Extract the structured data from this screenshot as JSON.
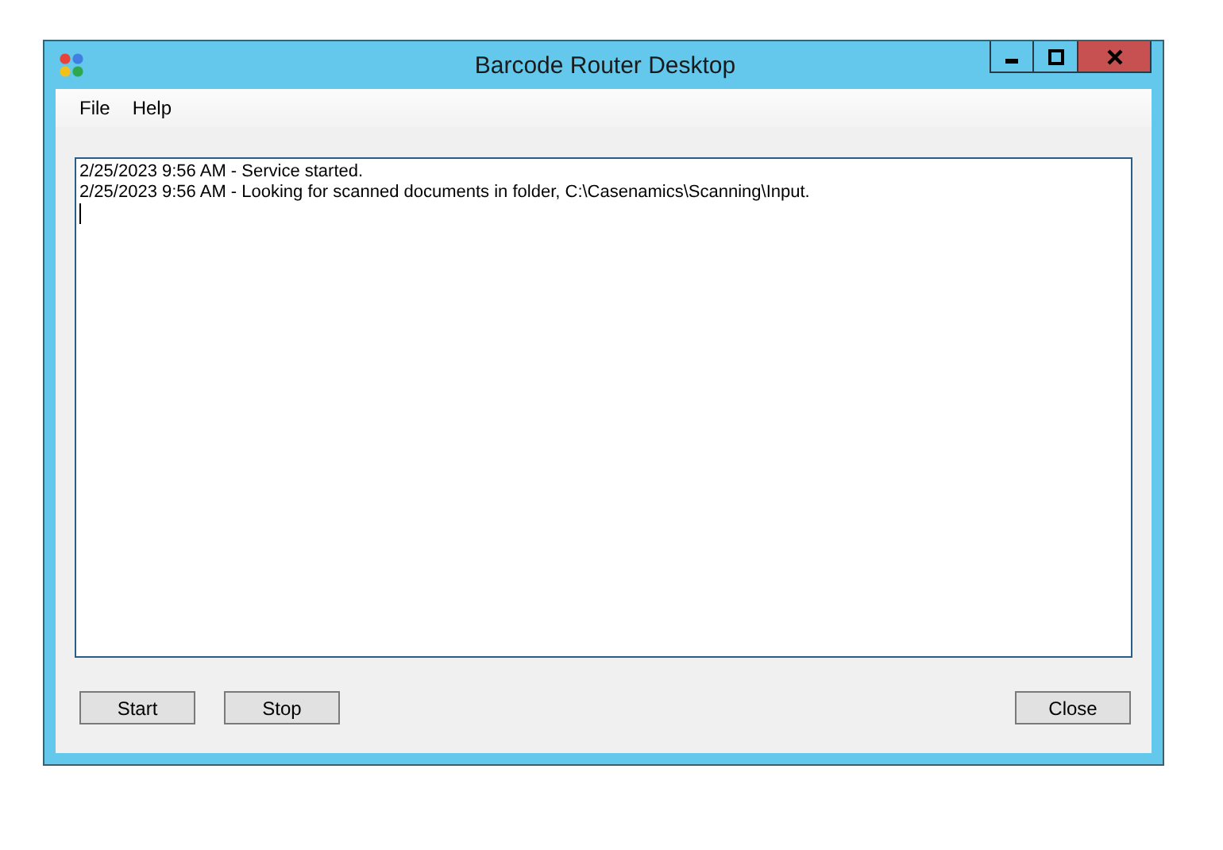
{
  "window": {
    "title": "Barcode Router Desktop"
  },
  "menu": [
    "File",
    "Help"
  ],
  "log": {
    "lines": [
      "2/25/2023 9:56 AM - Service started.",
      "2/25/2023 9:56 AM - Looking for scanned documents in folder, C:\\Casenamics\\Scanning\\Input."
    ]
  },
  "buttons_left": [
    "Start",
    "Stop"
  ],
  "buttons_right": [
    "Close"
  ]
}
